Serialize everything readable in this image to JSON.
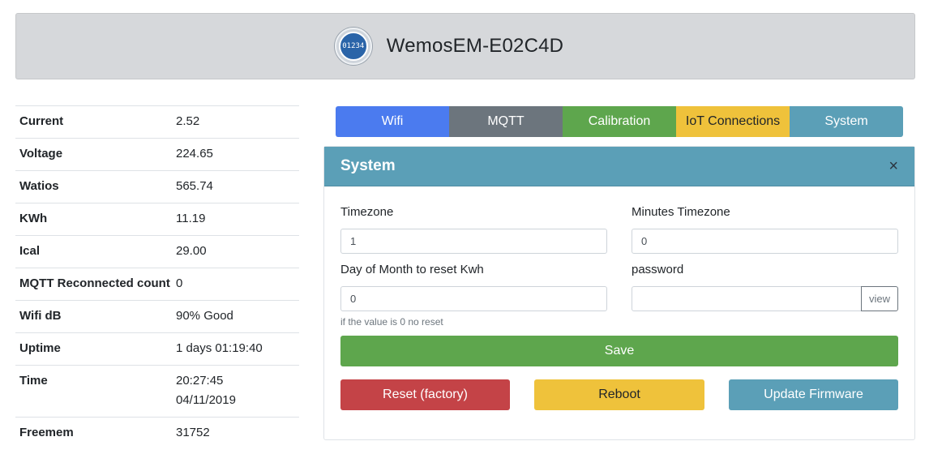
{
  "header": {
    "logo_text": "01234",
    "title": "WemosEM-E02C4D"
  },
  "stats": [
    {
      "label": "Current",
      "value": "2.52"
    },
    {
      "label": "Voltage",
      "value": "224.65"
    },
    {
      "label": "Watios",
      "value": "565.74"
    },
    {
      "label": "KWh",
      "value": "11.19"
    },
    {
      "label": "Ical",
      "value": "29.00"
    },
    {
      "label": "MQTT Reconnected count",
      "value": "0"
    },
    {
      "label": "Wifi dB",
      "value": "90% Good"
    },
    {
      "label": "Uptime",
      "value": "1 days 01:19:40"
    },
    {
      "label": "Time",
      "value": "20:27:45",
      "value2": "04/11/2019"
    },
    {
      "label": "Freemem",
      "value": "31752"
    }
  ],
  "tabs": [
    {
      "label": "Wifi"
    },
    {
      "label": "MQTT"
    },
    {
      "label": "Calibration"
    },
    {
      "label": "IoT Connections"
    },
    {
      "label": "System"
    }
  ],
  "panel": {
    "title": "System",
    "close_label": "×",
    "timezone": {
      "label": "Timezone",
      "value": "1"
    },
    "minutes_timezone": {
      "label": "Minutes Timezone",
      "value": "0"
    },
    "reset_day": {
      "label": "Day of Month to reset Kwh",
      "value": "0",
      "help": "if the value is 0 no reset"
    },
    "password": {
      "label": "password",
      "value": "",
      "view_label": "view"
    },
    "save_label": "Save",
    "reset_label": "Reset (factory)",
    "reboot_label": "Reboot",
    "update_label": "Update Firmware"
  },
  "colors": {
    "wifi_tab": "#4b7bef",
    "mqtt_tab": "#6c757d",
    "calibration_tab": "#5ea64d",
    "iot_tab": "#efc23b",
    "system_tab": "#5b9fb7",
    "danger": "#c44347"
  }
}
